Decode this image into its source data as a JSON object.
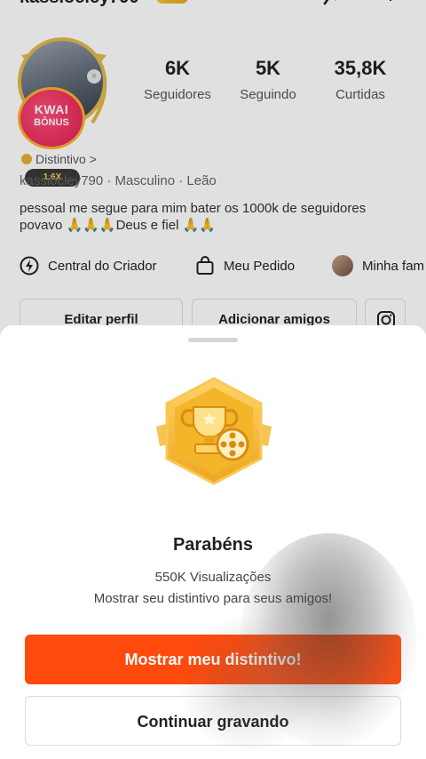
{
  "profile": {
    "username": "kassiocley790",
    "stats": [
      {
        "value": "6K",
        "label": "Seguidores"
      },
      {
        "value": "5K",
        "label": "Seguindo"
      },
      {
        "value": "35,8K",
        "label": "Curtidas"
      }
    ],
    "bonus_badge": {
      "line1": "KWAI",
      "line2": "BÔNUS"
    },
    "multiplier": "1.6X",
    "distintivo_label": "Distintivo >",
    "meta": "kassiocley790 · Masculino · Leão",
    "bio": "pessoal me segue para mim bater os 1000k de seguidores povavo 🙏🙏🙏Deus e fiel 🙏🙏",
    "quick_actions": [
      {
        "label": "Central do Criador",
        "icon": "lightning-circle-icon"
      },
      {
        "label": "Meu Pedido",
        "icon": "shopping-bag-icon"
      },
      {
        "label": "Minha fam",
        "icon": "avatar-icon"
      }
    ],
    "buttons": {
      "edit_profile": "Editar perfil",
      "add_friends": "Adicionar amigos"
    }
  },
  "sheet": {
    "title": "Parabéns",
    "views": "550K Visualizações",
    "description": "Mostrar seu distintivo para seus amigos!",
    "primary_button": "Mostrar meu distintivo!",
    "secondary_button": "Continuar gravando"
  },
  "colors": {
    "accent": "#ff4a0d",
    "badge_gold": "#f3b52a",
    "bonus_pink": "#e01e52"
  }
}
